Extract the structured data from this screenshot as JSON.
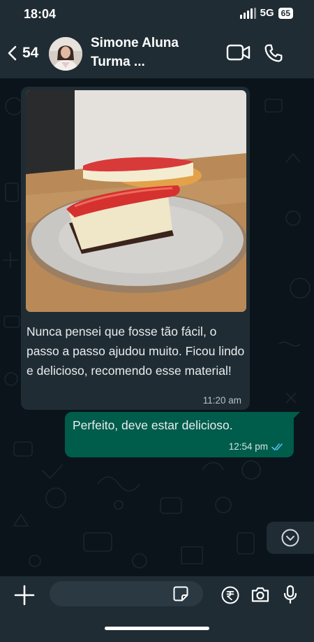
{
  "status_bar": {
    "time": "18:04",
    "network": "5G",
    "battery": "65"
  },
  "header": {
    "unread_count": "54",
    "contact_name_line1": "Simone Aluna",
    "contact_name_line2": "Turma ...",
    "icons": [
      "back-arrow-icon",
      "video-call-icon",
      "phone-icon"
    ]
  },
  "messages": [
    {
      "direction": "incoming",
      "image": "cheesecake slice with red topping on a grey plate",
      "text": " Nunca pensei que fosse tão fácil, o passo a passo ajudou muito. Ficou lindo e delicioso, recomendo esse material!",
      "time": "11:20 am"
    },
    {
      "direction": "outgoing",
      "text": "Perfeito, deve estar delicioso.",
      "time": "12:54 pm",
      "status": "read"
    }
  ],
  "input_bar": {
    "placeholder": "",
    "icons": [
      "plus-icon",
      "sticker-icon",
      "rupee-payment-icon",
      "camera-icon",
      "microphone-icon"
    ]
  },
  "colors": {
    "background": "#0b141a",
    "bar": "#1f2c34",
    "incoming_bubble": "#202c33",
    "outgoing_bubble": "#005c4b",
    "read_ticks": "#53bdeb"
  }
}
